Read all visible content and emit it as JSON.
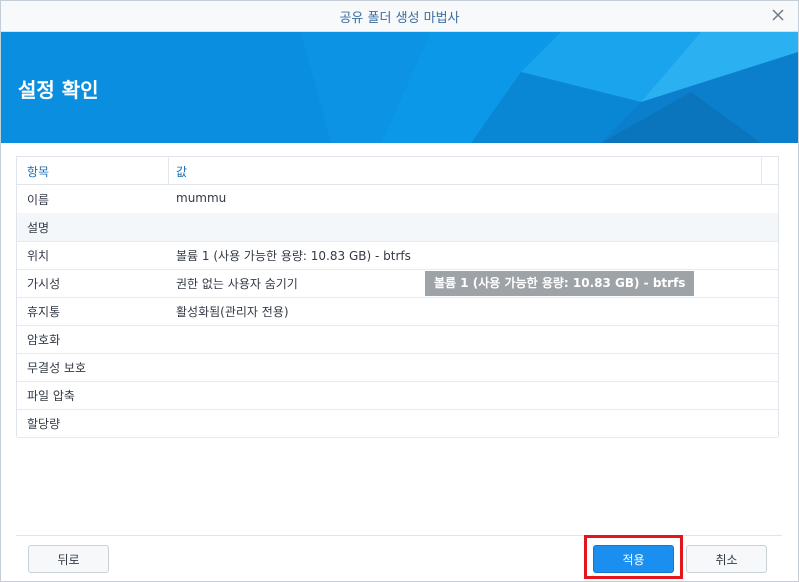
{
  "window": {
    "title": "공유 폴더 생성 마법사"
  },
  "banner": {
    "heading": "설정 확인"
  },
  "grid": {
    "headers": {
      "item": "항목",
      "value": "값"
    },
    "rows": [
      {
        "key": "이름",
        "value": "mummu"
      },
      {
        "key": "설명",
        "value": ""
      },
      {
        "key": "위치",
        "value": "볼륨 1 (사용 가능한 용량: 10.83 GB) - btrfs"
      },
      {
        "key": "가시성",
        "value": "권한 없는 사용자 숨기기"
      },
      {
        "key": "휴지통",
        "value": "활성화됨(관리자 전용)"
      },
      {
        "key": "암호화",
        "value": ""
      },
      {
        "key": "무결성 보호",
        "value": ""
      },
      {
        "key": "파일 압축",
        "value": ""
      },
      {
        "key": "할당량",
        "value": ""
      }
    ]
  },
  "tooltip": {
    "text": "볼륨 1 (사용 가능한 용량: 10.83 GB) - btrfs"
  },
  "footer": {
    "back_label": "뒤로",
    "apply_label": "적용",
    "cancel_label": "취소"
  },
  "colors": {
    "accent": "#1b8ff0",
    "banner": "#0a8fe0",
    "highlight": "#e3161b",
    "header_text": "#1e6fb3"
  },
  "icons": {
    "close": "close-icon"
  }
}
